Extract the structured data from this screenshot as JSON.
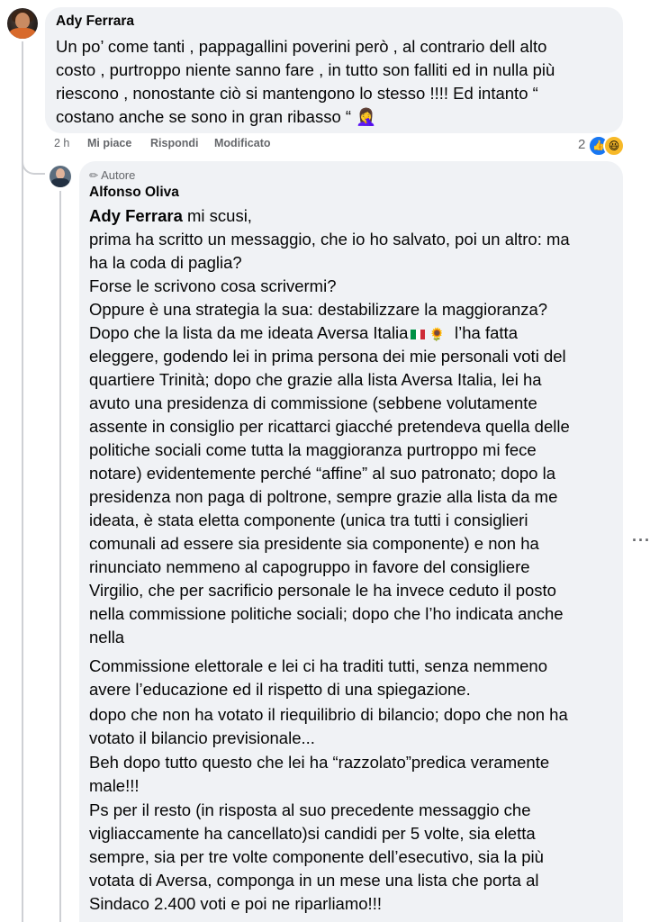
{
  "top_comment": {
    "author": "Ady Ferrara",
    "lines": [
      "Un po’ come tanti , pappagallini poverini però , al contrario dell alto",
      "costo , purtroppo niente sanno fare , in tutto son falliti ed in nulla più",
      "riescono , nonostante ciò si mantengono lo stesso !!!! Ed intanto “",
      "costano anche se sono in gran ribasso “ 🤦‍♀️"
    ],
    "time": "2 h",
    "like_label": "Mi piace",
    "reply_label": "Rispondi",
    "edited_label": "Modificato",
    "reaction_count": "2",
    "reaction_icons": [
      "like-icon",
      "haha-icon"
    ]
  },
  "reply": {
    "badge_label": "Autore",
    "author": "Alfonso Oliva",
    "mention": "Ady Ferrara",
    "first_line_rest": " mi scusi,",
    "lines": [
      "prima ha scritto un messaggio, che io ho salvato, poi un altro: ma",
      "ha la coda di paglia?",
      "Forse le scrivono cosa scrivermi?",
      "Oppure è una strategia la sua: destabilizzare la maggioranza?",
      "Dopo che la lista da me ideata Aversa Italia",
      "l’ha fatta",
      "eleggere, godendo lei in prima persona dei mie personali voti del",
      "quartiere Trinità; dopo che grazie alla lista Aversa Italia, lei ha",
      "avuto una presidenza di commissione (sebbene volutamente",
      "assente in consiglio per ricattarci giacché pretendeva quella delle",
      "politiche sociali come tutta la maggioranza purtroppo mi fece",
      "notare) evidentemente perché “affine” al suo patronato; dopo la",
      "presidenza non paga di poltrone, sempre grazie alla lista da me",
      "ideata, è stata eletta componente (unica tra tutti i consiglieri",
      "comunali ad essere sia presidente sia componente) e non ha",
      "rinunciato nemmeno al capogruppo in favore del consigliere",
      "Virgilio, che per sacrificio personale le ha invece ceduto il posto",
      "nella commissione politiche sociali; dopo che l’ho indicata anche",
      "nella",
      "Commissione elettorale e lei ci ha traditi tutti, senza nemmeno",
      "avere l’educazione ed il rispetto di una spiegazione.",
      "dopo che non ha votato il riequilibrio di bilancio; dopo che non ha",
      "votato il bilancio previsionale...",
      "Beh dopo tutto questo che lei ha “razzolato”predica veramente",
      "male!!!",
      "Ps per il resto (in risposta al suo precedente messaggio che",
      "vigliaccamente ha cancellato)si candidi per 5 volte, sia eletta",
      "sempre, sia per tre volte componente dell’esecutivo, sia la più",
      "votata di Aversa, componga in un mese una lista che porta al",
      "Sindaco 2.400 voti e poi ne riparliamo!!!"
    ],
    "inline_icons": [
      "italy-flag-icon",
      "sun-icon"
    ]
  },
  "more_options": "···",
  "colors": {
    "bubble": "#f0f2f5",
    "meta_text": "#65676b",
    "like_blue": "#1877f2",
    "haha_yellow": "#f7b928",
    "thread_line": "#ced0d4"
  }
}
